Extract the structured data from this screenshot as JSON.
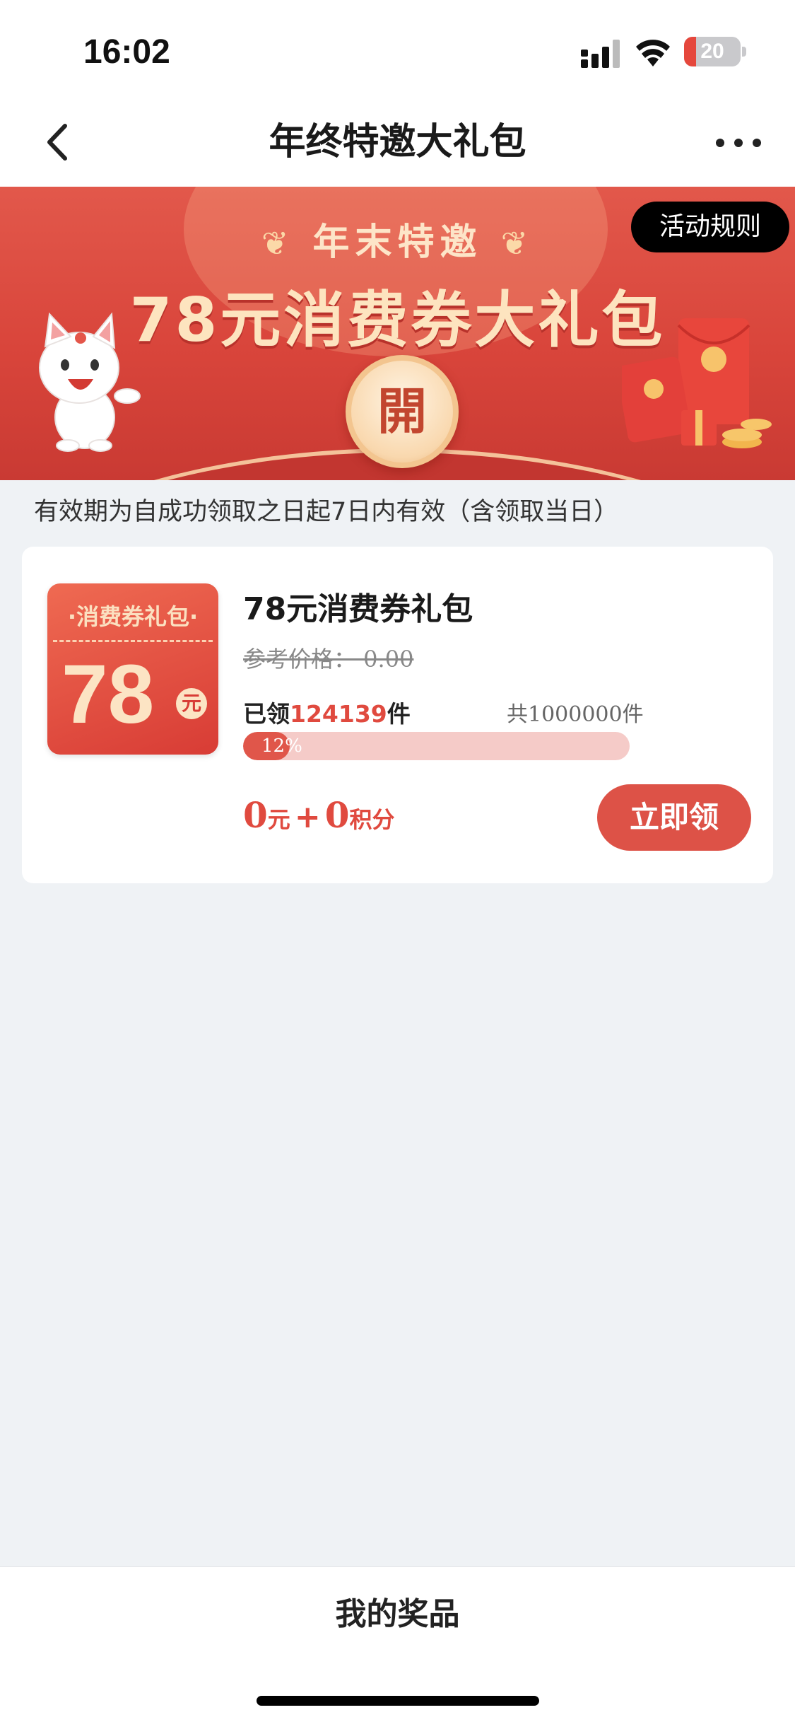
{
  "status_bar": {
    "time": "16:02",
    "battery": "20"
  },
  "nav": {
    "title": "年终特邀大礼包"
  },
  "banner": {
    "subtitle": "年末特邀",
    "title": "78元消费券大礼包",
    "open_label": "開",
    "rules_button": "活动规则"
  },
  "validity_note": "有效期为自成功领取之日起7日内有效（含领取当日）",
  "item": {
    "coupon_tag": "消费券礼包",
    "coupon_amount": "78",
    "coupon_unit": "元",
    "title": "78元消费券礼包",
    "ref_price": "参考价格： 0.00",
    "claimed_prefix": "已领",
    "claimed_count": "124139",
    "claimed_suffix": "件",
    "total": "共1000000件",
    "progress_label": "12%",
    "progress_fraction": 0.12,
    "price_cash": "0",
    "price_cash_unit": "元",
    "price_plus": "+",
    "price_points": "0",
    "price_points_unit": "积分",
    "claim_button": "立即领"
  },
  "bottom": {
    "my_prizes": "我的奖品"
  },
  "colors": {
    "accent": "#dd5247",
    "background": "#eff2f5"
  }
}
